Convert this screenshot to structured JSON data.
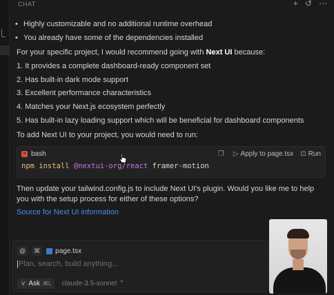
{
  "header": {
    "title": "CHAT",
    "icons": [
      "plus-icon",
      "history-icon",
      "more-icon"
    ]
  },
  "message": {
    "bullets": [
      "Highly customizable and no additional runtime overhead",
      "You already have some of the dependencies installed"
    ],
    "recommend_prefix": "For your specific project, I would recommend going with ",
    "recommend_bold": "Next UI",
    "recommend_suffix": " because:",
    "reasons": [
      "1. It provides a complete dashboard-ready component set",
      "2. Has built-in dark mode support",
      "3. Excellent performance characteristics",
      "4. Matches your Next.js ecosystem perfectly",
      "5. Has built-in lazy loading support which will be beneficial for dashboard components"
    ],
    "to_add": "To add Next UI to your project, you would need to run:",
    "then_update_1": "Then update your tailwind.config.js to include Next UI's plugin. Would you like me to help",
    "then_update_2": "you with the setup process for either of these options?",
    "source_link": "Source for Next UI information"
  },
  "code": {
    "language": "bash",
    "apply_label": "Apply to page.tsx",
    "run_label": "Run",
    "cmd": "npm install",
    "pkg": "@nextui-org/react",
    "rest": "framer-motion"
  },
  "composer": {
    "at_chip": "@",
    "image_chip": "⌘",
    "file_chip": "page.tsx",
    "placeholder": "Plan, search, build anything...",
    "ask_label": "Ask",
    "ask_shortcut": "⌘L",
    "model": "claude-3.5-sonnet"
  }
}
